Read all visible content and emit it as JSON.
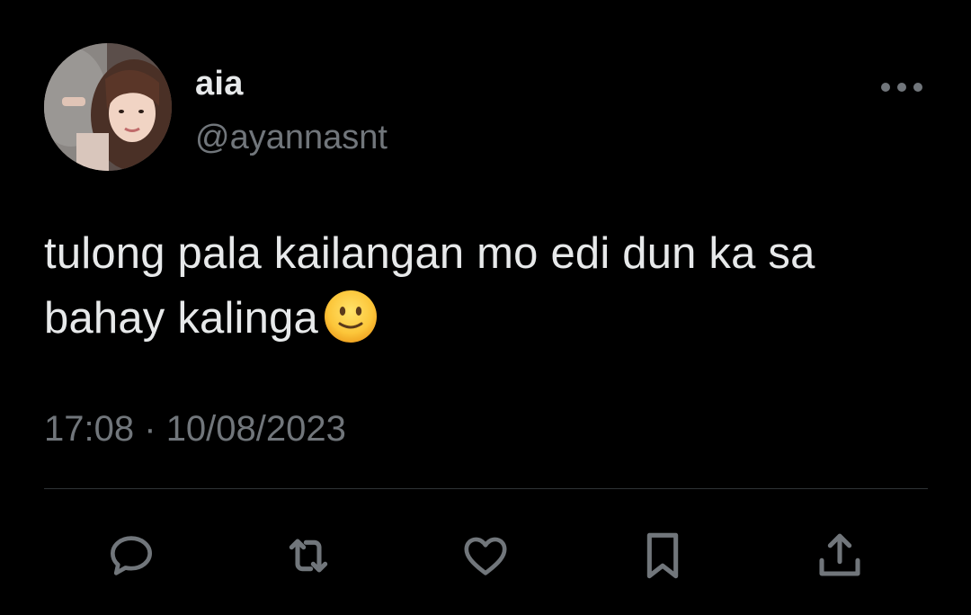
{
  "author": {
    "display_name": "aia",
    "handle": "@ayannasnt"
  },
  "tweet": {
    "text": "tulong pala kailangan mo edi dun ka sa bahay kalinga",
    "emoji": "slightly-smiling-face",
    "time": "17:08",
    "separator": "·",
    "date": "10/08/2023"
  },
  "actions": [
    {
      "name": "reply",
      "icon": "speech-bubble-icon"
    },
    {
      "name": "retweet",
      "icon": "retweet-icon"
    },
    {
      "name": "like",
      "icon": "heart-icon"
    },
    {
      "name": "bookmark",
      "icon": "bookmark-icon"
    },
    {
      "name": "share",
      "icon": "share-icon"
    }
  ],
  "colors": {
    "background": "#000000",
    "primary_text": "#e7e9ea",
    "secondary_text": "#71767b",
    "divider": "#2f3336"
  }
}
